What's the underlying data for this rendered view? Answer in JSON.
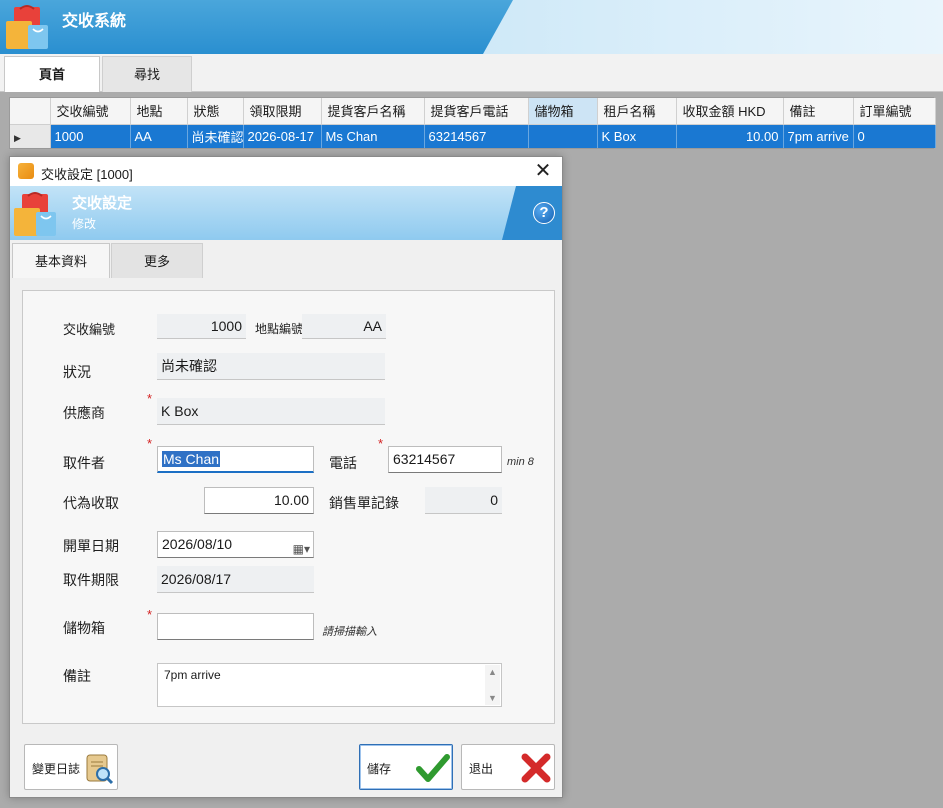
{
  "app": {
    "title": "交收系統"
  },
  "main_tabs": [
    {
      "label": "頁首"
    },
    {
      "label": "尋找"
    }
  ],
  "grid": {
    "columns": [
      "交收編號",
      "地點",
      "狀態",
      "領取限期",
      "提貨客戶名稱",
      "提貨客戶電話",
      "儲物箱",
      "租戶名稱",
      "收取金額 HKD",
      "備註",
      "訂單編號"
    ],
    "rows": [
      [
        "1000",
        "AA",
        "尚未確認",
        "2026-08-17",
        "Ms Chan",
        "63214567",
        "",
        "K Box",
        "10.00",
        "7pm arrive",
        "0"
      ]
    ]
  },
  "dialog": {
    "window_title": "交收設定 [1000]",
    "banner_title": "交收設定",
    "banner_subtitle": "修改",
    "tabs": [
      {
        "label": "基本資料"
      },
      {
        "label": "更多"
      }
    ],
    "fields": {
      "delivery_no_label": "交收編號",
      "delivery_no": "1000",
      "location_no_label": "地點編號",
      "location_no": "AA",
      "status_label": "狀況",
      "status": "尚未確認",
      "supplier_label": "供應商",
      "supplier": "K Box",
      "recipient_label": "取件者",
      "recipient": "Ms Chan",
      "phone_label": "電話",
      "phone": "63214567",
      "phone_hint": "min 8",
      "collect_label": "代為收取",
      "collect": "10.00",
      "sales_label": "銷售單記錄",
      "sales": "0",
      "open_date_label": "開單日期",
      "open_date": "2026/08/10",
      "deadline_label": "取件期限",
      "deadline": "2026/08/17",
      "locker_label": "儲物箱",
      "locker": "",
      "locker_hint": "請掃描輸入",
      "remark_label": "備註",
      "remark": "7pm arrive"
    },
    "buttons": {
      "changelog": "變更日誌",
      "save": "儲存",
      "exit": "退出"
    }
  },
  "colors": {
    "accent": "#1a78d2",
    "banner": "#2a8fd0",
    "required": "#d32020"
  }
}
